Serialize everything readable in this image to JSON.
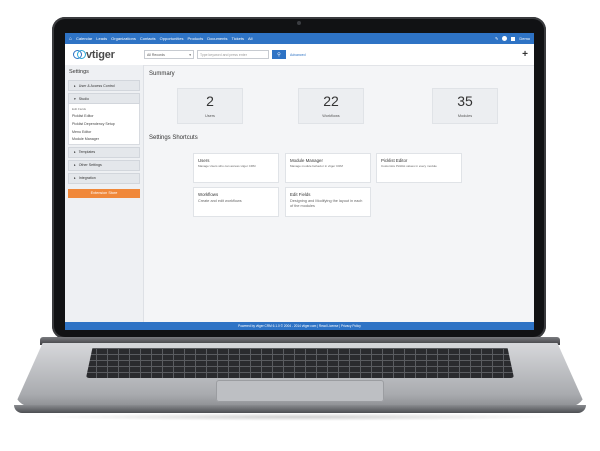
{
  "topnav": {
    "home_icon": "home-icon",
    "items": [
      "Calendar",
      "Leads",
      "Organizations",
      "Contacts",
      "Opportunities",
      "Products",
      "Documents",
      "Tickets",
      "All"
    ],
    "right_icons": [
      "wrench-icon",
      "help-icon",
      "user-icon"
    ],
    "user_label": "Demo"
  },
  "header": {
    "logo_text": "vtiger",
    "module_select": "All Records",
    "search_placeholder": "Type keyword and press enter",
    "advanced_label": "Advanced",
    "add_icon": "+"
  },
  "sidebar": {
    "title": "Settings",
    "sections": [
      {
        "label": "User & Access Control"
      },
      {
        "label": "Studio",
        "items": [
          "Edit Fields",
          "Picklist Editor",
          "Picklist Dependency Setup",
          "Menu Editor",
          "Module Manager"
        ]
      },
      {
        "label": "Templates"
      },
      {
        "label": "Other Settings"
      },
      {
        "label": "Integration"
      }
    ],
    "extension_store": "Extension Store"
  },
  "main": {
    "summary_title": "Summary",
    "summary": [
      {
        "value": "2",
        "label": "Users"
      },
      {
        "value": "22",
        "label": "Workflows"
      },
      {
        "value": "35",
        "label": "Modules"
      }
    ],
    "shortcuts_title": "Settings Shortcuts",
    "shortcuts": [
      {
        "title": "Users",
        "desc": "Manage Users who can access vtiger CRM"
      },
      {
        "title": "Module Manager",
        "desc": "Manage module behavior in vtiger CRM"
      },
      {
        "title": "Picklist Editor",
        "desc": "Customize Picklist values in every module"
      },
      {
        "title": "Workflows",
        "desc": "Create and edit workflows"
      },
      {
        "title": "Edit Fields",
        "desc": "Designing and Modifying the layout in each of the modules"
      }
    ]
  },
  "footer": {
    "text": "Powered by vtiger CRM 6.1.0 © 2004 - 2014 vtiger.com | Read License | Privacy Policy"
  }
}
